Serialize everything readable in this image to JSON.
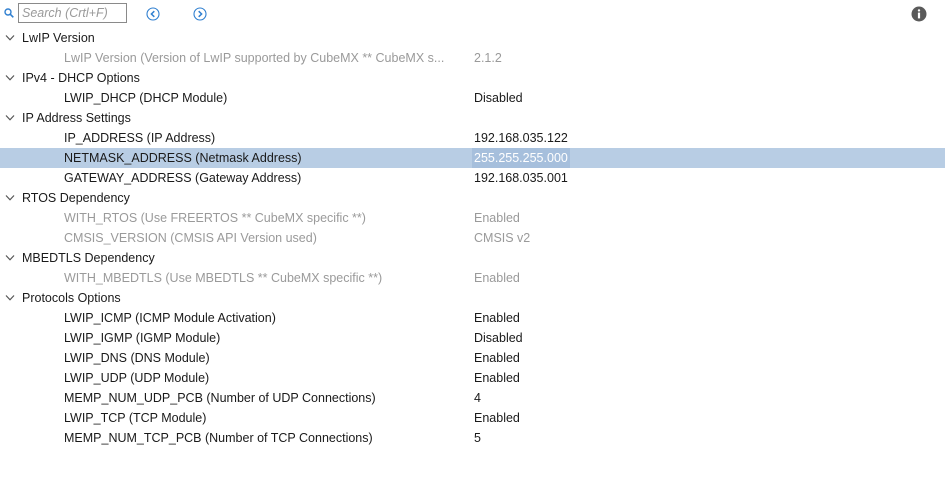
{
  "toolbar": {
    "search_placeholder": "Search (Crtl+F)",
    "icons": {
      "search": "search-icon",
      "prev": "arrow-left-circle-icon",
      "next": "arrow-right-circle-icon",
      "info": "info-icon"
    }
  },
  "colors": {
    "selection": "#b8cde4",
    "disabled_text": "#9a9a9a",
    "icon_blue": "#2f7fd0",
    "info_gray": "#5a5a5a"
  },
  "groups": [
    {
      "label": "LwIP Version",
      "expanded": true,
      "params": [
        {
          "name": "LwIP Version (Version of LwIP supported by CubeMX ** CubeMX s...",
          "value": "2.1.2",
          "disabled": true
        }
      ]
    },
    {
      "label": "IPv4 - DHCP Options",
      "expanded": true,
      "params": [
        {
          "name": "LWIP_DHCP (DHCP Module)",
          "value": "Disabled",
          "disabled": false
        }
      ]
    },
    {
      "label": "IP Address Settings",
      "expanded": true,
      "params": [
        {
          "name": "IP_ADDRESS (IP Address)",
          "value": "192.168.035.122",
          "disabled": false
        },
        {
          "name": "NETMASK_ADDRESS (Netmask Address)",
          "value": "255.255.255.000",
          "disabled": false,
          "selected": true
        },
        {
          "name": "GATEWAY_ADDRESS (Gateway Address)",
          "value": "192.168.035.001",
          "disabled": false
        }
      ]
    },
    {
      "label": "RTOS Dependency",
      "expanded": true,
      "params": [
        {
          "name": "WITH_RTOS (Use FREERTOS ** CubeMX specific **)",
          "value": "Enabled",
          "disabled": true
        },
        {
          "name": "CMSIS_VERSION (CMSIS API Version used)",
          "value": "CMSIS v2",
          "disabled": true
        }
      ]
    },
    {
      "label": "MBEDTLS Dependency",
      "expanded": true,
      "params": [
        {
          "name": "WITH_MBEDTLS (Use MBEDTLS ** CubeMX specific **)",
          "value": "Enabled",
          "disabled": true
        }
      ]
    },
    {
      "label": "Protocols Options",
      "expanded": true,
      "params": [
        {
          "name": "LWIP_ICMP (ICMP Module Activation)",
          "value": "Enabled",
          "disabled": false
        },
        {
          "name": "LWIP_IGMP (IGMP Module)",
          "value": "Disabled",
          "disabled": false
        },
        {
          "name": "LWIP_DNS (DNS Module)",
          "value": "Enabled",
          "disabled": false
        },
        {
          "name": "LWIP_UDP (UDP Module)",
          "value": "Enabled",
          "disabled": false
        },
        {
          "name": "MEMP_NUM_UDP_PCB (Number of UDP Connections)",
          "value": "4",
          "disabled": false
        },
        {
          "name": "LWIP_TCP (TCP Module)",
          "value": "Enabled",
          "disabled": false
        },
        {
          "name": "MEMP_NUM_TCP_PCB (Number of TCP Connections)",
          "value": "5",
          "disabled": false
        }
      ]
    }
  ]
}
